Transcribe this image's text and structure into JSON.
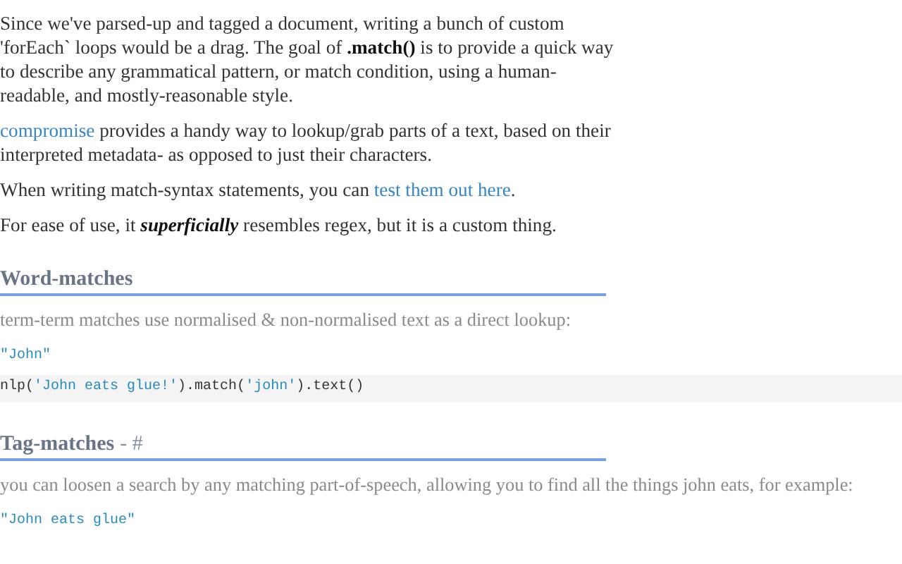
{
  "intro": [
    {
      "segments": [
        {
          "kind": "text",
          "text": "Since we've parsed-up and tagged a document, writing a bunch of custom 'forEach` loops would be a drag. The goal of **.match()** is to provide a quick way to describe any grammatical pattern, or match condition, using a human-readable, and mostly-reasonable style."
        }
      ]
    },
    {
      "segments": [
        {
          "kind": "link",
          "text": "compromise"
        },
        {
          "kind": "text",
          "text": " provides a handy way to lookup/grab parts of a text, based on their interpreted metadata- as opposed to just their characters."
        }
      ]
    },
    {
      "segments": [
        {
          "kind": "text",
          "text": "When writing match-syntax statements, you can "
        },
        {
          "kind": "link",
          "text": "test them out here"
        },
        {
          "kind": "text",
          "text": "."
        }
      ]
    },
    {
      "segments": [
        {
          "kind": "text",
          "text": "For ease of use, it "
        },
        {
          "kind": "emphasis",
          "text": "superficially"
        },
        {
          "kind": "text",
          "text": " resembles regex, but it is a custom thing."
        }
      ]
    }
  ],
  "sections": [
    {
      "title": "Word-matches",
      "description": "term-term matches use normalised & non-normalised text as a direct lookup:",
      "blocks": [
        {
          "kind": "match",
          "tokens": [
            {
              "kind": "string",
              "text": "\"John\""
            }
          ]
        },
        {
          "kind": "code",
          "tokens": [
            {
              "kind": "plain",
              "text": "nlp("
            },
            {
              "kind": "string",
              "text": "'John eats glue!'"
            },
            {
              "kind": "plain",
              "text": ").match("
            },
            {
              "kind": "string",
              "text": "'john'"
            },
            {
              "kind": "plain",
              "text": ").text()"
            }
          ]
        }
      ]
    },
    {
      "title": "Tag-matches",
      "anchor": "- #",
      "description": "you can loosen a search by any matching part-of-speech, allowing you to find all the things john eats, for example:",
      "blocks": [
        {
          "kind": "match",
          "tokens": [
            {
              "kind": "string",
              "text": "\"John eats glue\""
            }
          ]
        }
      ]
    }
  ]
}
